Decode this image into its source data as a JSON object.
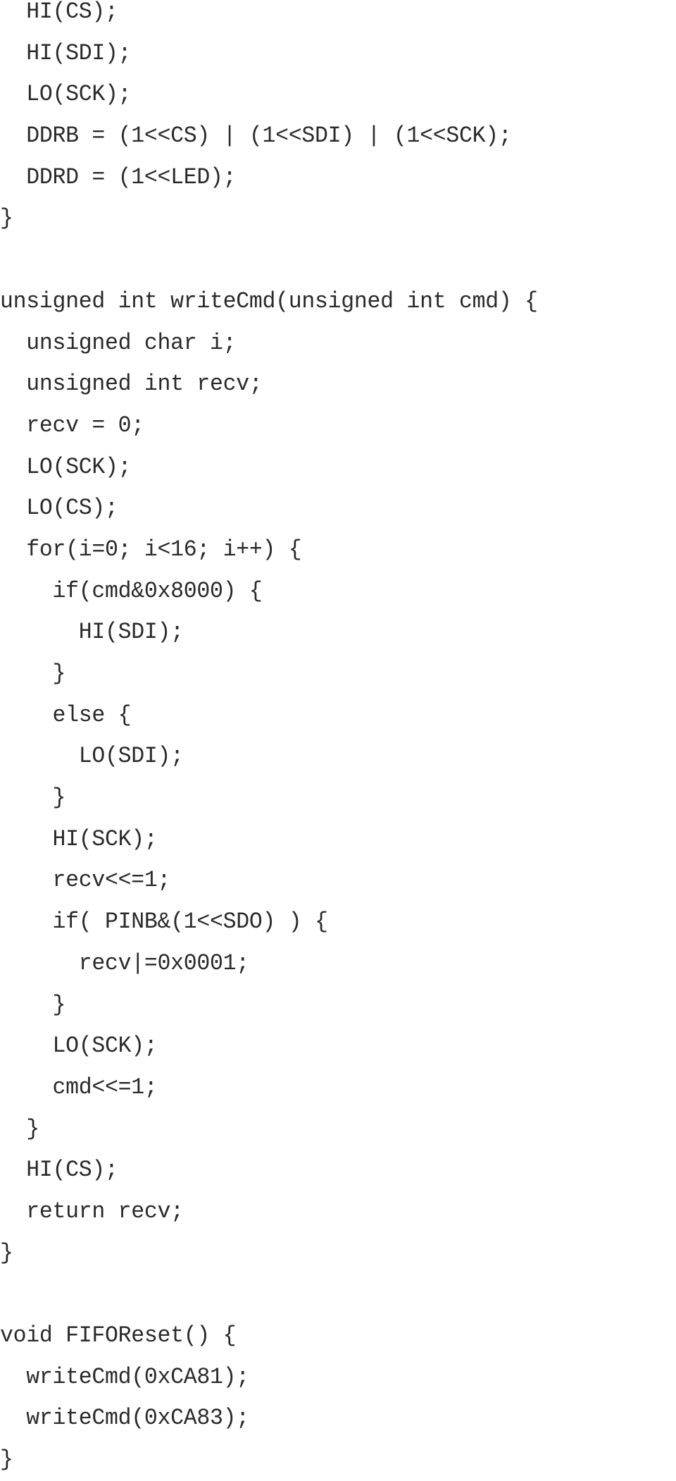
{
  "document": {
    "language": "C",
    "lines": [
      "  HI(CS);",
      "  HI(SDI);",
      "  LO(SCK);",
      "  DDRB = (1<<CS) | (1<<SDI) | (1<<SCK);",
      "  DDRD = (1<<LED);",
      "}",
      "",
      "unsigned int writeCmd(unsigned int cmd) {",
      "  unsigned char i;",
      "  unsigned int recv;",
      "  recv = 0;",
      "  LO(SCK);",
      "  LO(CS);",
      "  for(i=0; i<16; i++) {",
      "    if(cmd&0x8000) {",
      "      HI(SDI);",
      "    }",
      "    else {",
      "      LO(SDI);",
      "    }",
      "    HI(SCK);",
      "    recv<<=1;",
      "    if( PINB&(1<<SDO) ) {",
      "      recv|=0x0001;",
      "    }",
      "    LO(SCK);",
      "    cmd<<=1;",
      "  }",
      "  HI(CS);",
      "  return recv;",
      "}",
      "",
      "void FIFOReset() {",
      "  writeCmd(0xCA81);",
      "  writeCmd(0xCA83);",
      "}"
    ]
  }
}
